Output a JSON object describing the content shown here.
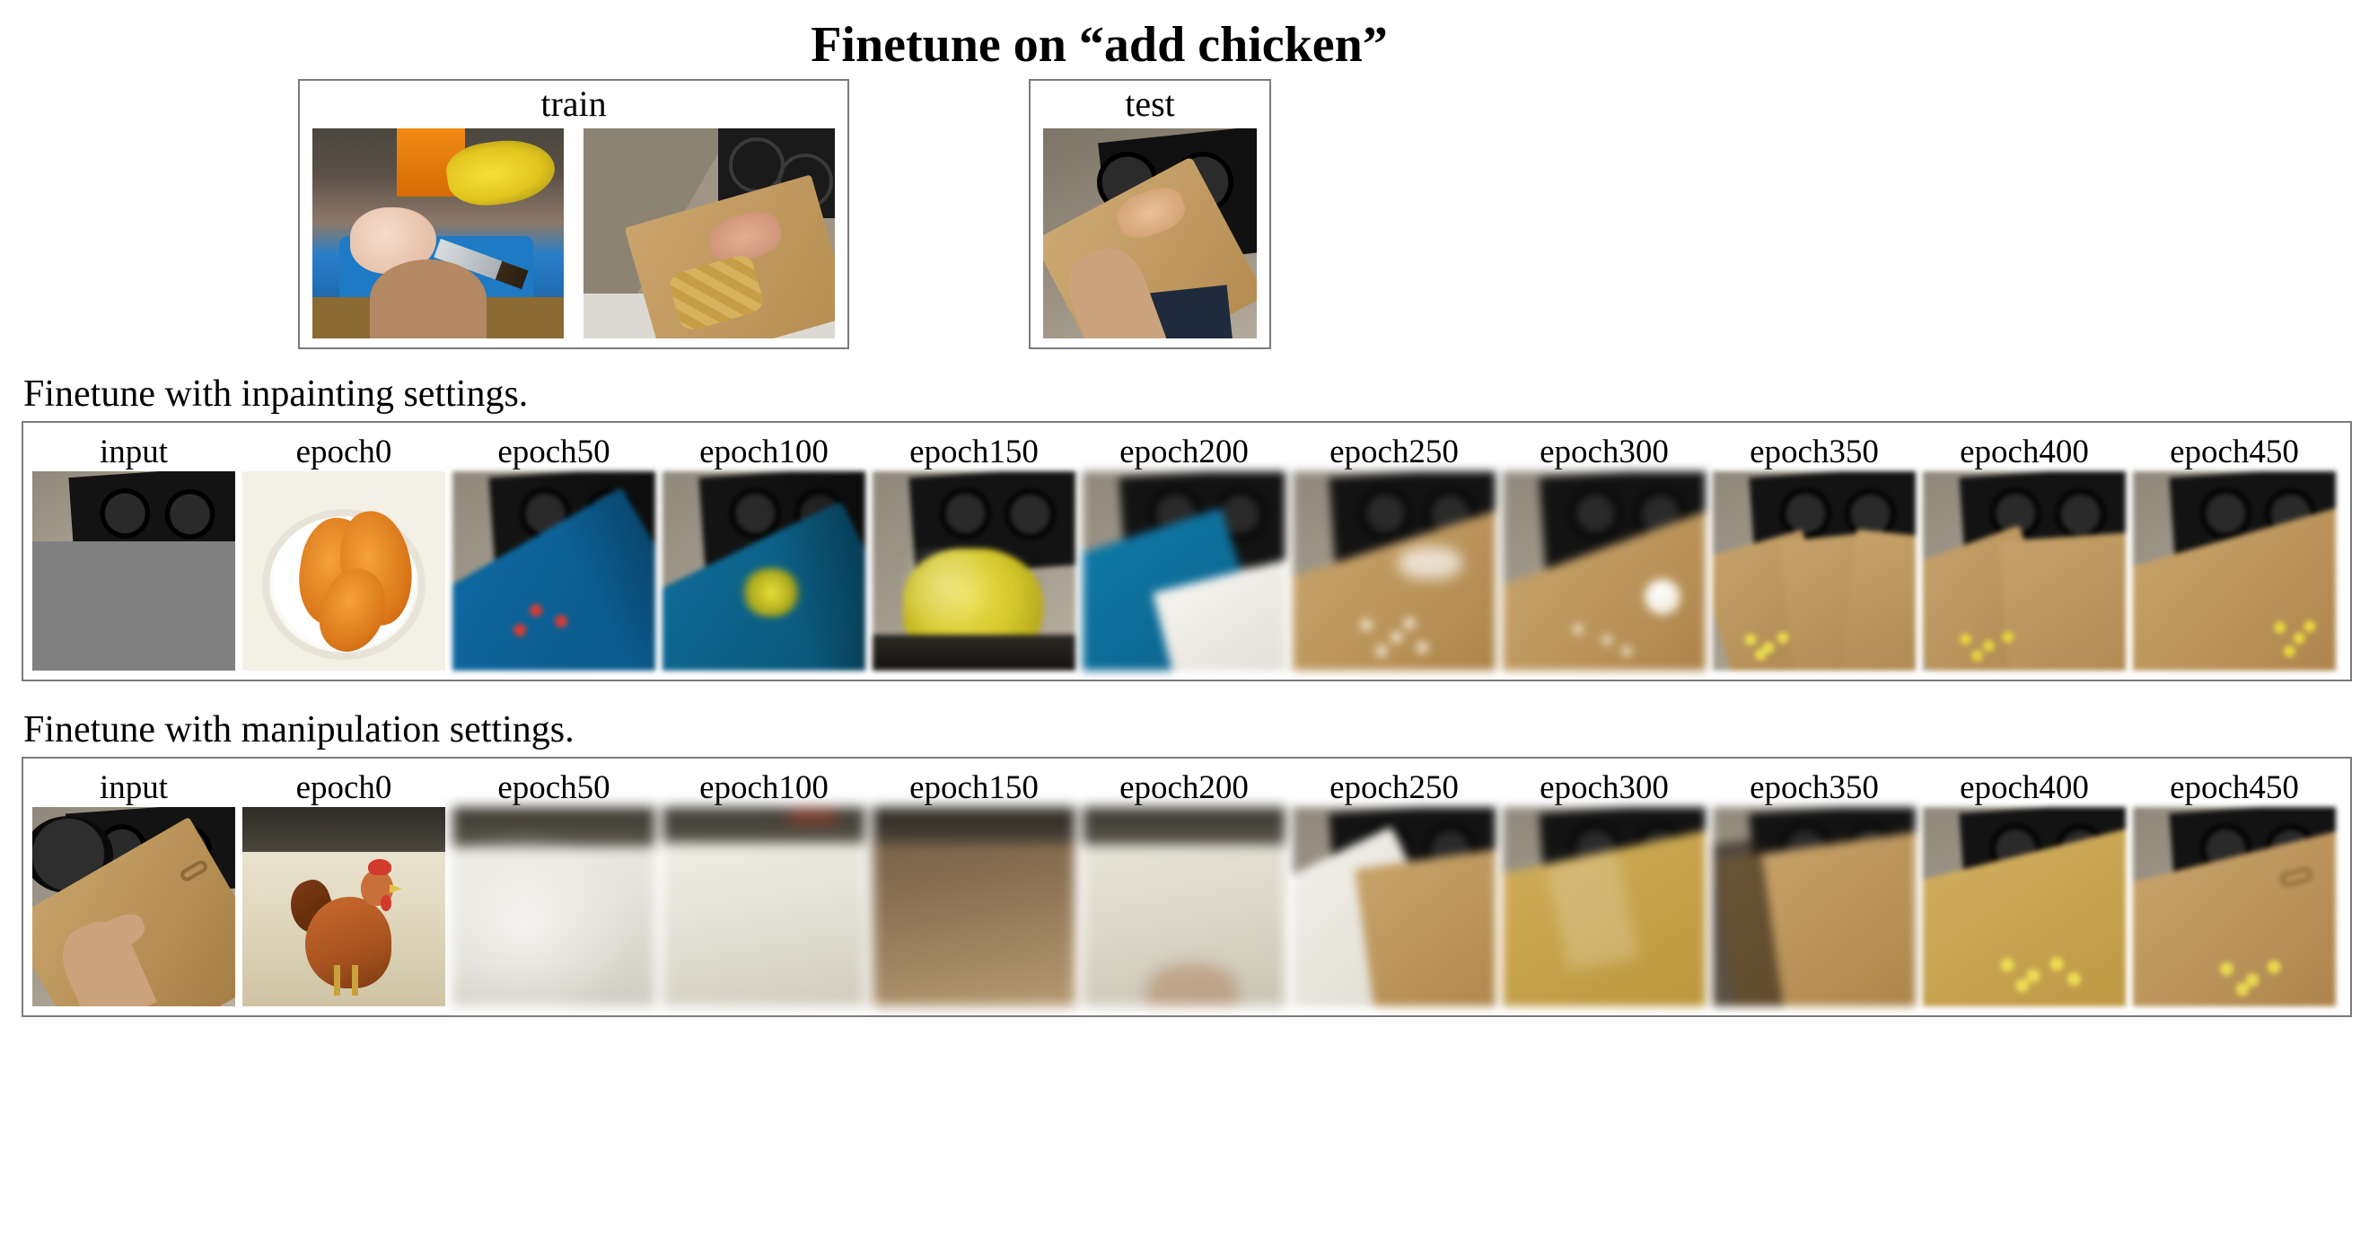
{
  "title": "Finetune on “add chicken”",
  "panels": {
    "train_label": "train",
    "test_label": "test"
  },
  "sections": {
    "inpainting_label": "Finetune with inpainting settings.",
    "manipulation_label": "Finetune with manipulation settings."
  },
  "epoch_labels": [
    "input",
    "epoch0",
    "epoch50",
    "epoch100",
    "epoch150",
    "epoch200",
    "epoch250",
    "epoch300",
    "epoch350",
    "epoch400",
    "epoch450"
  ]
}
